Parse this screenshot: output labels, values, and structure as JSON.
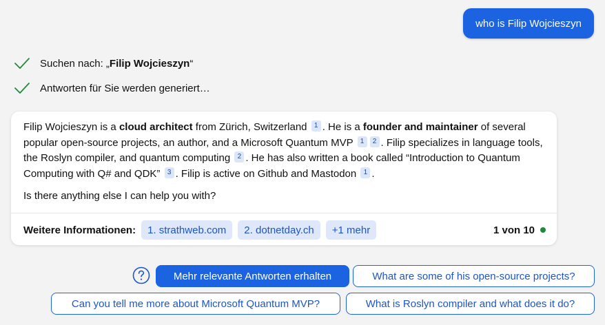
{
  "user_message": "who is Filip Wojcieszyn",
  "status": {
    "search_prefix": "Suchen nach: „",
    "search_query": "Filip Wojcieszyn",
    "search_suffix": "“",
    "generating": "Antworten für Sie werden generiert…"
  },
  "answer": {
    "s1": "Filip Wojcieszyn is a ",
    "b1": "cloud architect",
    "s2": " from Zürich, Switzerland ",
    "c1": "1",
    "s3": ". He is a ",
    "b2": "founder and maintainer",
    "s4": " of several popular open-source projects, an author, and a Microsoft Quantum MVP ",
    "c2": "1",
    "c3": "2",
    "s5": ". Filip specializes in language tools, the Roslyn compiler, and quantum computing ",
    "c4": "2",
    "s6": ". He has also written a book called “Introduction to Quantum Computing with Q# and QDK” ",
    "c5": "3",
    "s7": ". Filip is active on Github and Mastodon ",
    "c6": "1",
    "s8": ".",
    "followup": "Is there anything else I can help you with?"
  },
  "more_info": {
    "label": "Weitere Informationen:",
    "sources": [
      "1. strathweb.com",
      "2. dotnetday.ch",
      "+1 mehr"
    ],
    "counter": "1 von 10"
  },
  "suggestions": {
    "primary": "Mehr relevante Antworten erhalten",
    "s1": "What are some of his open-source projects?",
    "s2": "Can you tell me more about Microsoft Quantum MVP?",
    "s3": "What is Roslyn compiler and what does it do?"
  },
  "colors": {
    "accent": "#1b63e0",
    "check": "#1f8a3b"
  }
}
